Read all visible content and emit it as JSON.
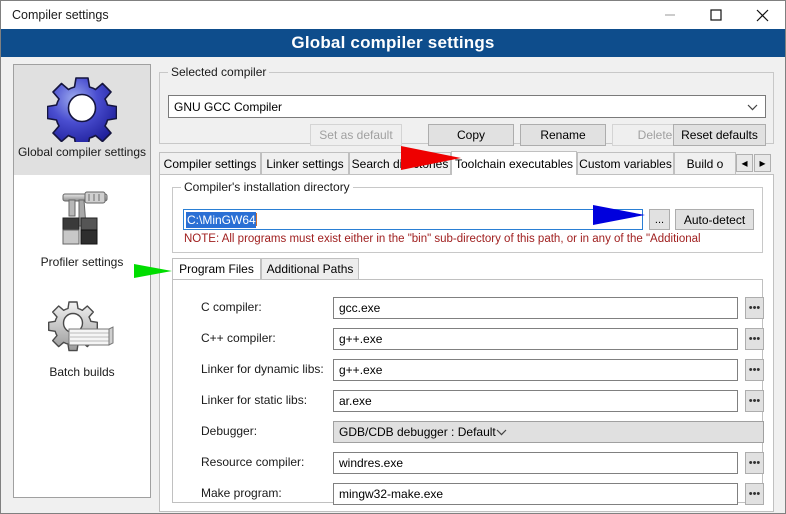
{
  "window": {
    "titlebar_text": "Compiler settings",
    "banner_title": "Global compiler settings",
    "minimize_label": "Minimize",
    "maximize_label": "Maximize",
    "close_label": "Close",
    "banner_color": "#0e4d8c"
  },
  "sidebar": {
    "items": [
      {
        "label": "Global compiler settings",
        "icon": "gear-blue-icon",
        "selected": true
      },
      {
        "label": "Profiler settings",
        "icon": "caliper-icon",
        "selected": false
      },
      {
        "label": "Batch builds",
        "icon": "gear-stack-icon",
        "selected": false
      }
    ]
  },
  "selected_compiler_group": {
    "legend": "Selected compiler",
    "combo_value": "GNU GCC Compiler",
    "buttons": [
      {
        "label": "Set as default",
        "enabled": false
      },
      {
        "label": "Copy",
        "enabled": true
      },
      {
        "label": "Rename",
        "enabled": true
      },
      {
        "label": "Delete",
        "enabled": false
      },
      {
        "label": "Reset defaults",
        "enabled": true
      }
    ]
  },
  "tabs": {
    "items": [
      {
        "label": "Compiler settings",
        "active": false
      },
      {
        "label": "Linker settings",
        "active": false
      },
      {
        "label": "Search directories",
        "active": false
      },
      {
        "label": "Toolchain executables",
        "active": true
      },
      {
        "label": "Custom variables",
        "active": false
      },
      {
        "label": "Build o",
        "active": false
      }
    ],
    "scroll_left": "◂",
    "scroll_right": "▸"
  },
  "install_group": {
    "legend": "Compiler's installation directory",
    "path_value": "C:\\MinGW64",
    "browse_label": "...",
    "autodetect_label": "Auto-detect",
    "note": "NOTE: All programs must exist either in the \"bin\" sub-directory of this path, or in any of the \"Additional"
  },
  "inner_tabs": {
    "items": [
      {
        "label": "Program Files",
        "active": true
      },
      {
        "label": "Additional Paths",
        "active": false
      }
    ]
  },
  "program_files": {
    "browse_label": "•••",
    "rows": [
      {
        "label": "C compiler:",
        "value": "gcc.exe",
        "type": "text"
      },
      {
        "label": "C++ compiler:",
        "value": "g++.exe",
        "type": "text"
      },
      {
        "label": "Linker for dynamic libs:",
        "value": "g++.exe",
        "type": "text"
      },
      {
        "label": "Linker for static libs:",
        "value": "ar.exe",
        "type": "text"
      },
      {
        "label": "Debugger:",
        "value": "GDB/CDB debugger : Default",
        "type": "combo"
      },
      {
        "label": "Resource compiler:",
        "value": "windres.exe",
        "type": "text"
      },
      {
        "label": "Make program:",
        "value": "mingw32-make.exe",
        "type": "text"
      }
    ]
  },
  "annotations": [
    {
      "name": "red-arrow-toolchain-tab",
      "color": "#ee0000"
    },
    {
      "name": "blue-arrow-path-field",
      "color": "#0000dd"
    },
    {
      "name": "green-arrow-program-files-tab",
      "color": "#00dd00"
    }
  ]
}
